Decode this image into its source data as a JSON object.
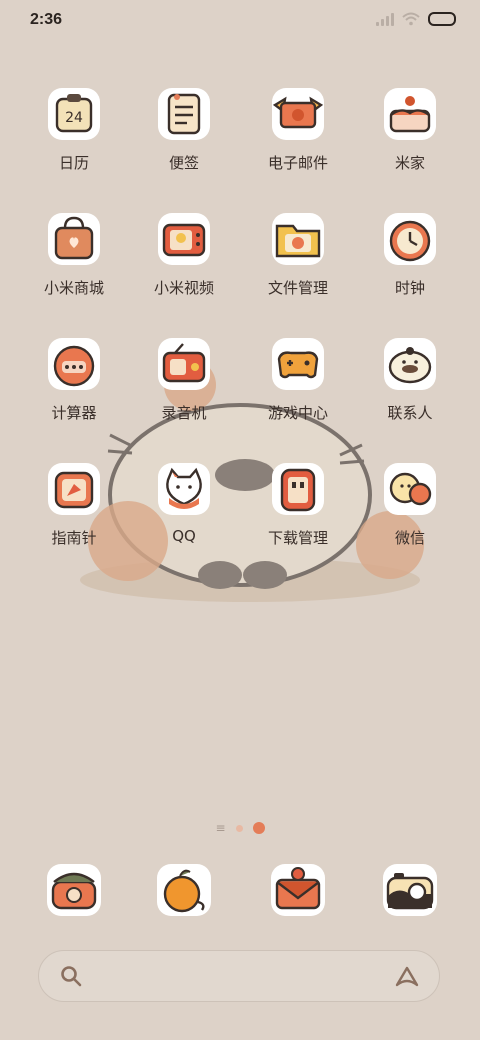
{
  "status": {
    "time": "2:36"
  },
  "apps": [
    {
      "label": "日历",
      "icon": "calendar-icon",
      "badge": "24"
    },
    {
      "label": "便签",
      "icon": "notes-icon"
    },
    {
      "label": "电子邮件",
      "icon": "email-icon"
    },
    {
      "label": "米家",
      "icon": "cake-home-icon"
    },
    {
      "label": "小米商城",
      "icon": "shopping-bag-icon"
    },
    {
      "label": "小米视频",
      "icon": "tv-icon"
    },
    {
      "label": "文件管理",
      "icon": "folder-icon"
    },
    {
      "label": "时钟",
      "icon": "clock-icon"
    },
    {
      "label": "计算器",
      "icon": "calculator-icon"
    },
    {
      "label": "录音机",
      "icon": "radio-icon"
    },
    {
      "label": "游戏中心",
      "icon": "gamepad-icon"
    },
    {
      "label": "联系人",
      "icon": "contacts-bird-icon"
    },
    {
      "label": "指南针",
      "icon": "compass-icon"
    },
    {
      "label": "QQ",
      "icon": "cat-qq-icon"
    },
    {
      "label": "下载管理",
      "icon": "download-icon"
    },
    {
      "label": "微信",
      "icon": "chat-fruit-icon"
    }
  ],
  "dock": [
    {
      "name": "phone",
      "icon": "phone-icon"
    },
    {
      "name": "messages",
      "icon": "orange-messages-icon"
    },
    {
      "name": "browser",
      "icon": "envelope-browser-icon"
    },
    {
      "name": "camera",
      "icon": "camera-icon"
    }
  ],
  "colors": {
    "background": "#ddd2c8",
    "accent": "#e47d58"
  }
}
